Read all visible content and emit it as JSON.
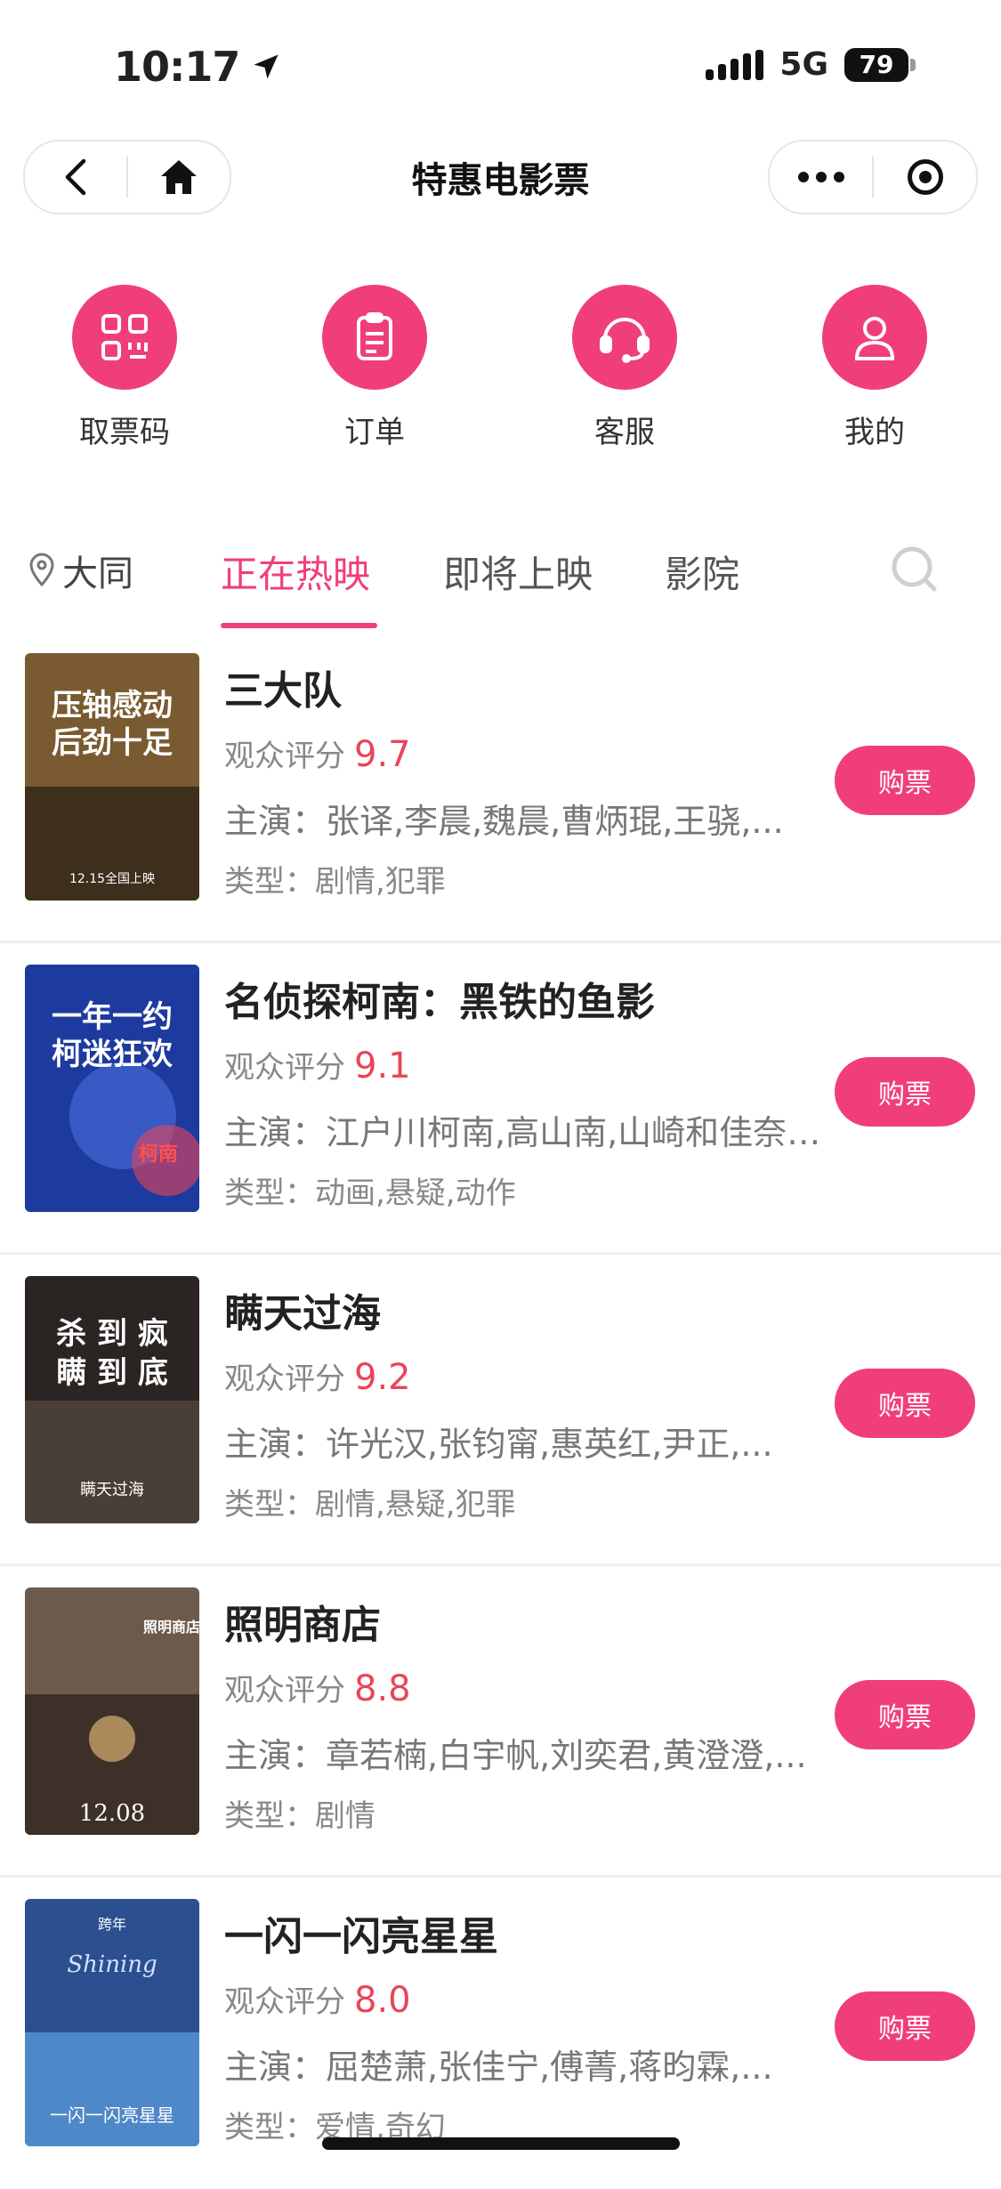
{
  "status_bar": {
    "time": "10:17",
    "network": "5G",
    "battery": "79"
  },
  "nav": {
    "title": "特惠电影票"
  },
  "quick_actions": [
    {
      "label": "取票码",
      "icon": "qr-code-icon"
    },
    {
      "label": "订单",
      "icon": "order-list-icon"
    },
    {
      "label": "客服",
      "icon": "headset-icon"
    },
    {
      "label": "我的",
      "icon": "user-icon"
    }
  ],
  "location": {
    "city": "大同"
  },
  "tabs": [
    {
      "label": "正在热映",
      "active": true
    },
    {
      "label": "即将上映",
      "active": false
    },
    {
      "label": "影院",
      "active": false
    }
  ],
  "labels": {
    "rating": "观众评分",
    "cast": "主演：",
    "genre": "类型：",
    "buy": "购票"
  },
  "movies": [
    {
      "title": "三大队",
      "score": "9.7",
      "cast": "张译,李晨,魏晨,曹炳琨,王骁,...",
      "genre": "剧情,犯罪",
      "poster_lines": [
        "压轴感动",
        "后劲十足",
        "12.15全国上映"
      ],
      "poster_color": "#8a6a3a"
    },
    {
      "title": "名侦探柯南：黑铁的鱼影",
      "score": "9.1",
      "cast": "江户川柯南,高山南,山崎和佳奈,...",
      "genre": "动画,悬疑,动作",
      "poster_lines": [
        "一年一约",
        "柯迷狂欢",
        "柯南"
      ],
      "poster_color": "#1d3a9e"
    },
    {
      "title": "瞒天过海",
      "score": "9.2",
      "cast": "许光汉,张钧甯,惠英红,尹正,...",
      "genre": "剧情,悬疑,犯罪",
      "poster_lines": [
        "杀 到 疯",
        "瞒 到 底",
        "瞒天过海"
      ],
      "poster_color": "#3a3230"
    },
    {
      "title": "照明商店",
      "score": "8.8",
      "cast": "章若楠,白宇帆,刘奕君,黄澄澄,...",
      "genre": "剧情",
      "poster_lines": [
        "照明商店",
        "12.08"
      ],
      "poster_color": "#5f4a3c"
    },
    {
      "title": "一闪一闪亮星星",
      "score": "8.0",
      "cast": "屈楚萧,张佳宁,傅菁,蒋昀霖,...",
      "genre": "爱情,奇幻",
      "poster_lines": [
        "跨年",
        "Shining",
        "一闪一闪亮星星"
      ],
      "poster_color": "#2b4f8f"
    }
  ]
}
